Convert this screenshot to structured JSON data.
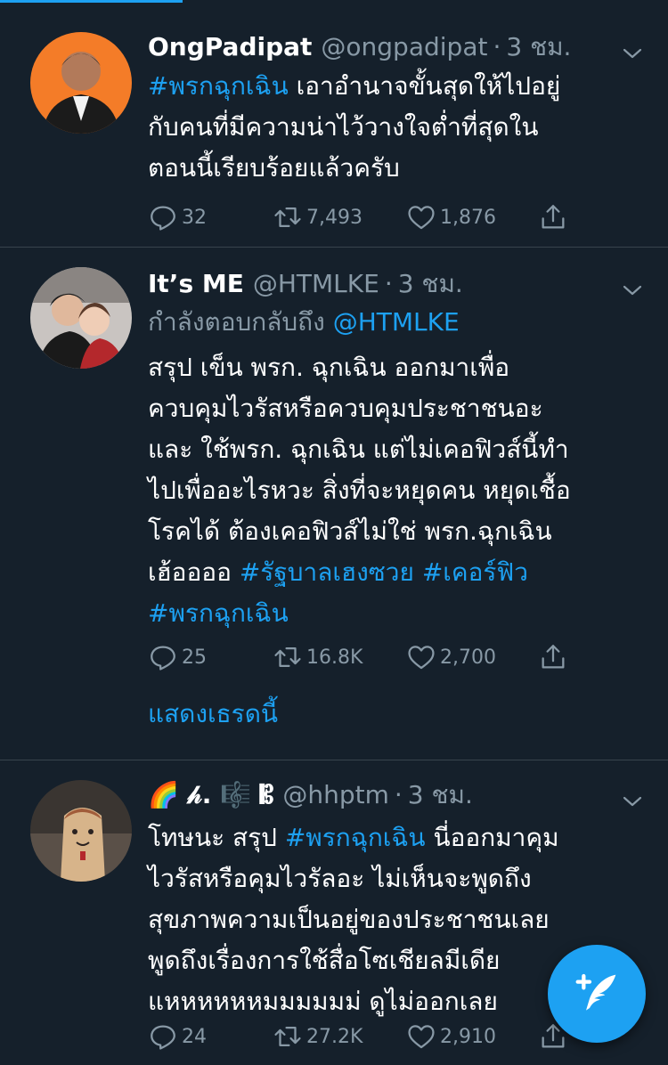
{
  "colors": {
    "background": "#15202b",
    "accent": "#1da1f2",
    "muted": "#8899a6",
    "divider": "#38444d"
  },
  "tweets": [
    {
      "display_name": "OngPadipat",
      "handle": "@ongpadipat",
      "dot": "·",
      "time": "3 ชม.",
      "reply_to": null,
      "lines": [
        [
          {
            "t": "#พรกฉุกเฉิน",
            "tag": true
          },
          {
            "t": " เอาอำนาจขั้นสุดให้ไปอยู่"
          }
        ],
        [
          {
            "t": "กับคนที่มีความน่าไว้วางใจต่ำที่สุดใน"
          }
        ],
        [
          {
            "t": "ตอนนี้เรียบร้อยแล้วครับ"
          }
        ]
      ],
      "replies": "32",
      "retweets": "7,493",
      "likes": "1,876"
    },
    {
      "display_name": "It’s ME",
      "handle": "@HTMLKE",
      "dot": "·",
      "time": "3 ชม.",
      "reply_to": {
        "prefix": "กำลังตอบกลับถึง",
        "mention": "@HTMLKE"
      },
      "lines": [
        [
          {
            "t": "สรุป เข็น พรก. ฉุกเฉิน ออกมาเพื่อ"
          }
        ],
        [
          {
            "t": "ควบคุมไวรัสหรือควบคุมประชาชนอะ"
          }
        ],
        [
          {
            "t": "และ ใช้พรก. ฉุกเฉิน แต่ไม่เคอฟิวส์นี้ทำ"
          }
        ],
        [
          {
            "t": "ไปเพื่ออะไรหวะ สิ่งที่จะหยุดคน หยุดเชื้อ"
          }
        ],
        [
          {
            "t": "โรคได้ ต้องเคอฟิวส์ไม่ใช่ พรก.ฉุกเฉิน"
          }
        ],
        [
          {
            "t": "เฮ้ออออ "
          },
          {
            "t": "#รัฐบาลเฮงซวย",
            "tag": true
          },
          {
            "t": " "
          },
          {
            "t": "#เคอร์ฟิว",
            "tag": true
          }
        ],
        [
          {
            "t": "#พรกฉุกเฉิน",
            "tag": true
          }
        ]
      ],
      "replies": "25",
      "retweets": "16.8K",
      "likes": "2,700",
      "show_thread": "แสดงเธรดนี้"
    },
    {
      "display_name": "🌈 𝒽. 🎼 𝄡",
      "handle": "@hhptm",
      "dot": "·",
      "time": "3 ชม.",
      "reply_to": null,
      "lines": [
        [
          {
            "t": "โทษนะ สรุป "
          },
          {
            "t": "#พรกฉุกเฉิน",
            "tag": true
          },
          {
            "t": " นี่ออกมาคุม"
          }
        ],
        [
          {
            "t": "ไวรัสหรือคุมไวรัลอะ ไม่เห็นจะพูดถึง"
          }
        ],
        [
          {
            "t": "สุขภาพความเป็นอยู่ของประชาชนเลย"
          }
        ],
        [
          {
            "t": "พูดถึงเรื่องการใช้สื่อโซเชียลมีเดีย"
          }
        ],
        [
          {
            "t": "แหหหหหหมมมมมม่ ดูไม่ออกเลย"
          }
        ]
      ],
      "replies": "24",
      "retweets": "27.2K",
      "likes": "2,910"
    }
  ],
  "icons": {
    "reply": "reply-icon",
    "retweet": "retweet-icon",
    "like": "heart-icon",
    "share": "share-icon",
    "caret": "chevron-down-icon",
    "compose": "compose-tweet-icon"
  }
}
